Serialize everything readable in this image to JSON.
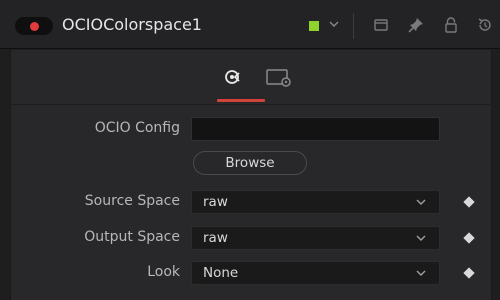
{
  "header": {
    "node_name": "OCIOColorspace1",
    "enable_color": "#e23b3b",
    "swatch_color": "#8fd42a",
    "icons": [
      "chevron-down-icon",
      "window-icon",
      "pin-icon",
      "lock-icon",
      "reset-icon"
    ]
  },
  "tabs": [
    {
      "icon": "colorspace-icon",
      "active": true
    },
    {
      "icon": "settings-icon",
      "active": false
    }
  ],
  "accent_color": "#d0423a",
  "fields": {
    "ocio_config": {
      "label": "OCIO Config",
      "value": ""
    },
    "browse_label": "Browse",
    "source_space": {
      "label": "Source Space",
      "value": "raw"
    },
    "output_space": {
      "label": "Output Space",
      "value": "raw"
    },
    "look": {
      "label": "Look",
      "value": "None"
    }
  }
}
